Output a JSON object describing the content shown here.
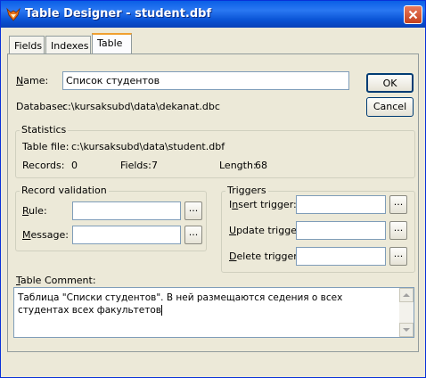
{
  "window": {
    "title": "Table Designer - student.dbf",
    "app_icon": "foxpro-fox-icon",
    "accent": "#0a54d6"
  },
  "tabs": [
    {
      "label": "Fields"
    },
    {
      "label": "Indexes"
    },
    {
      "label": "Table"
    }
  ],
  "name": {
    "label_hotkey": "N",
    "label_rest": "ame:",
    "value": "Список студентов"
  },
  "database": {
    "label": "Database:",
    "path": "c:\\kursaksubd\\data\\dekanat.dbc"
  },
  "buttons": {
    "ok": "OK",
    "cancel": "Cancel"
  },
  "statistics": {
    "title": "Statistics",
    "table_file_label": "Table file:",
    "table_file": "c:\\kursaksubd\\data\\student.dbf",
    "records_label": "Records:",
    "records": "0",
    "fields_label": "Fields:",
    "fields": "7",
    "length_label": "Length:",
    "length": "68"
  },
  "record_validation": {
    "title": "Record validation",
    "rule_hotkey": "R",
    "rule_rest": "ule:",
    "rule_value": "",
    "message_hotkey": "M",
    "message_rest": "essage:",
    "message_value": "",
    "ellipsis": "..."
  },
  "triggers": {
    "title": "Triggers",
    "insert_pre": "I",
    "insert_hotkey": "n",
    "insert_rest": "sert trigger:",
    "update_hotkey": "U",
    "update_rest": "pdate trigger:",
    "delete_hotkey": "D",
    "delete_rest": "elete trigger:",
    "ellipsis": "..."
  },
  "comment": {
    "label_hotkey": "T",
    "label_rest": "able Comment:",
    "text": "Таблица \"Списки студентов\". В ней размещаются седения о всех студентах всех факультетов"
  }
}
